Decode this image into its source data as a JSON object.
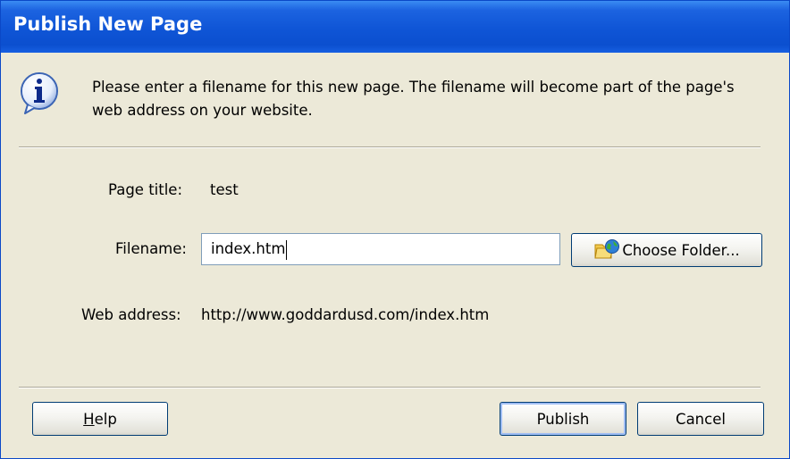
{
  "window": {
    "title": "Publish New Page"
  },
  "info": {
    "icon": "info-icon",
    "message": "Please enter a filename for this new page. The filename will become part of the page's web address on your website."
  },
  "page_title": {
    "label": "Page title:",
    "value": "test"
  },
  "filename": {
    "label": "Filename:",
    "value": "index.htm"
  },
  "choose_folder": {
    "label": "Choose Folder...",
    "icon": "folder-globe-icon"
  },
  "web_address": {
    "label": "Web address:",
    "value": "http://www.goddardusd.com/index.htm"
  },
  "buttons": {
    "help_rest": "elp",
    "publish": "Publish",
    "cancel": "Cancel"
  }
}
